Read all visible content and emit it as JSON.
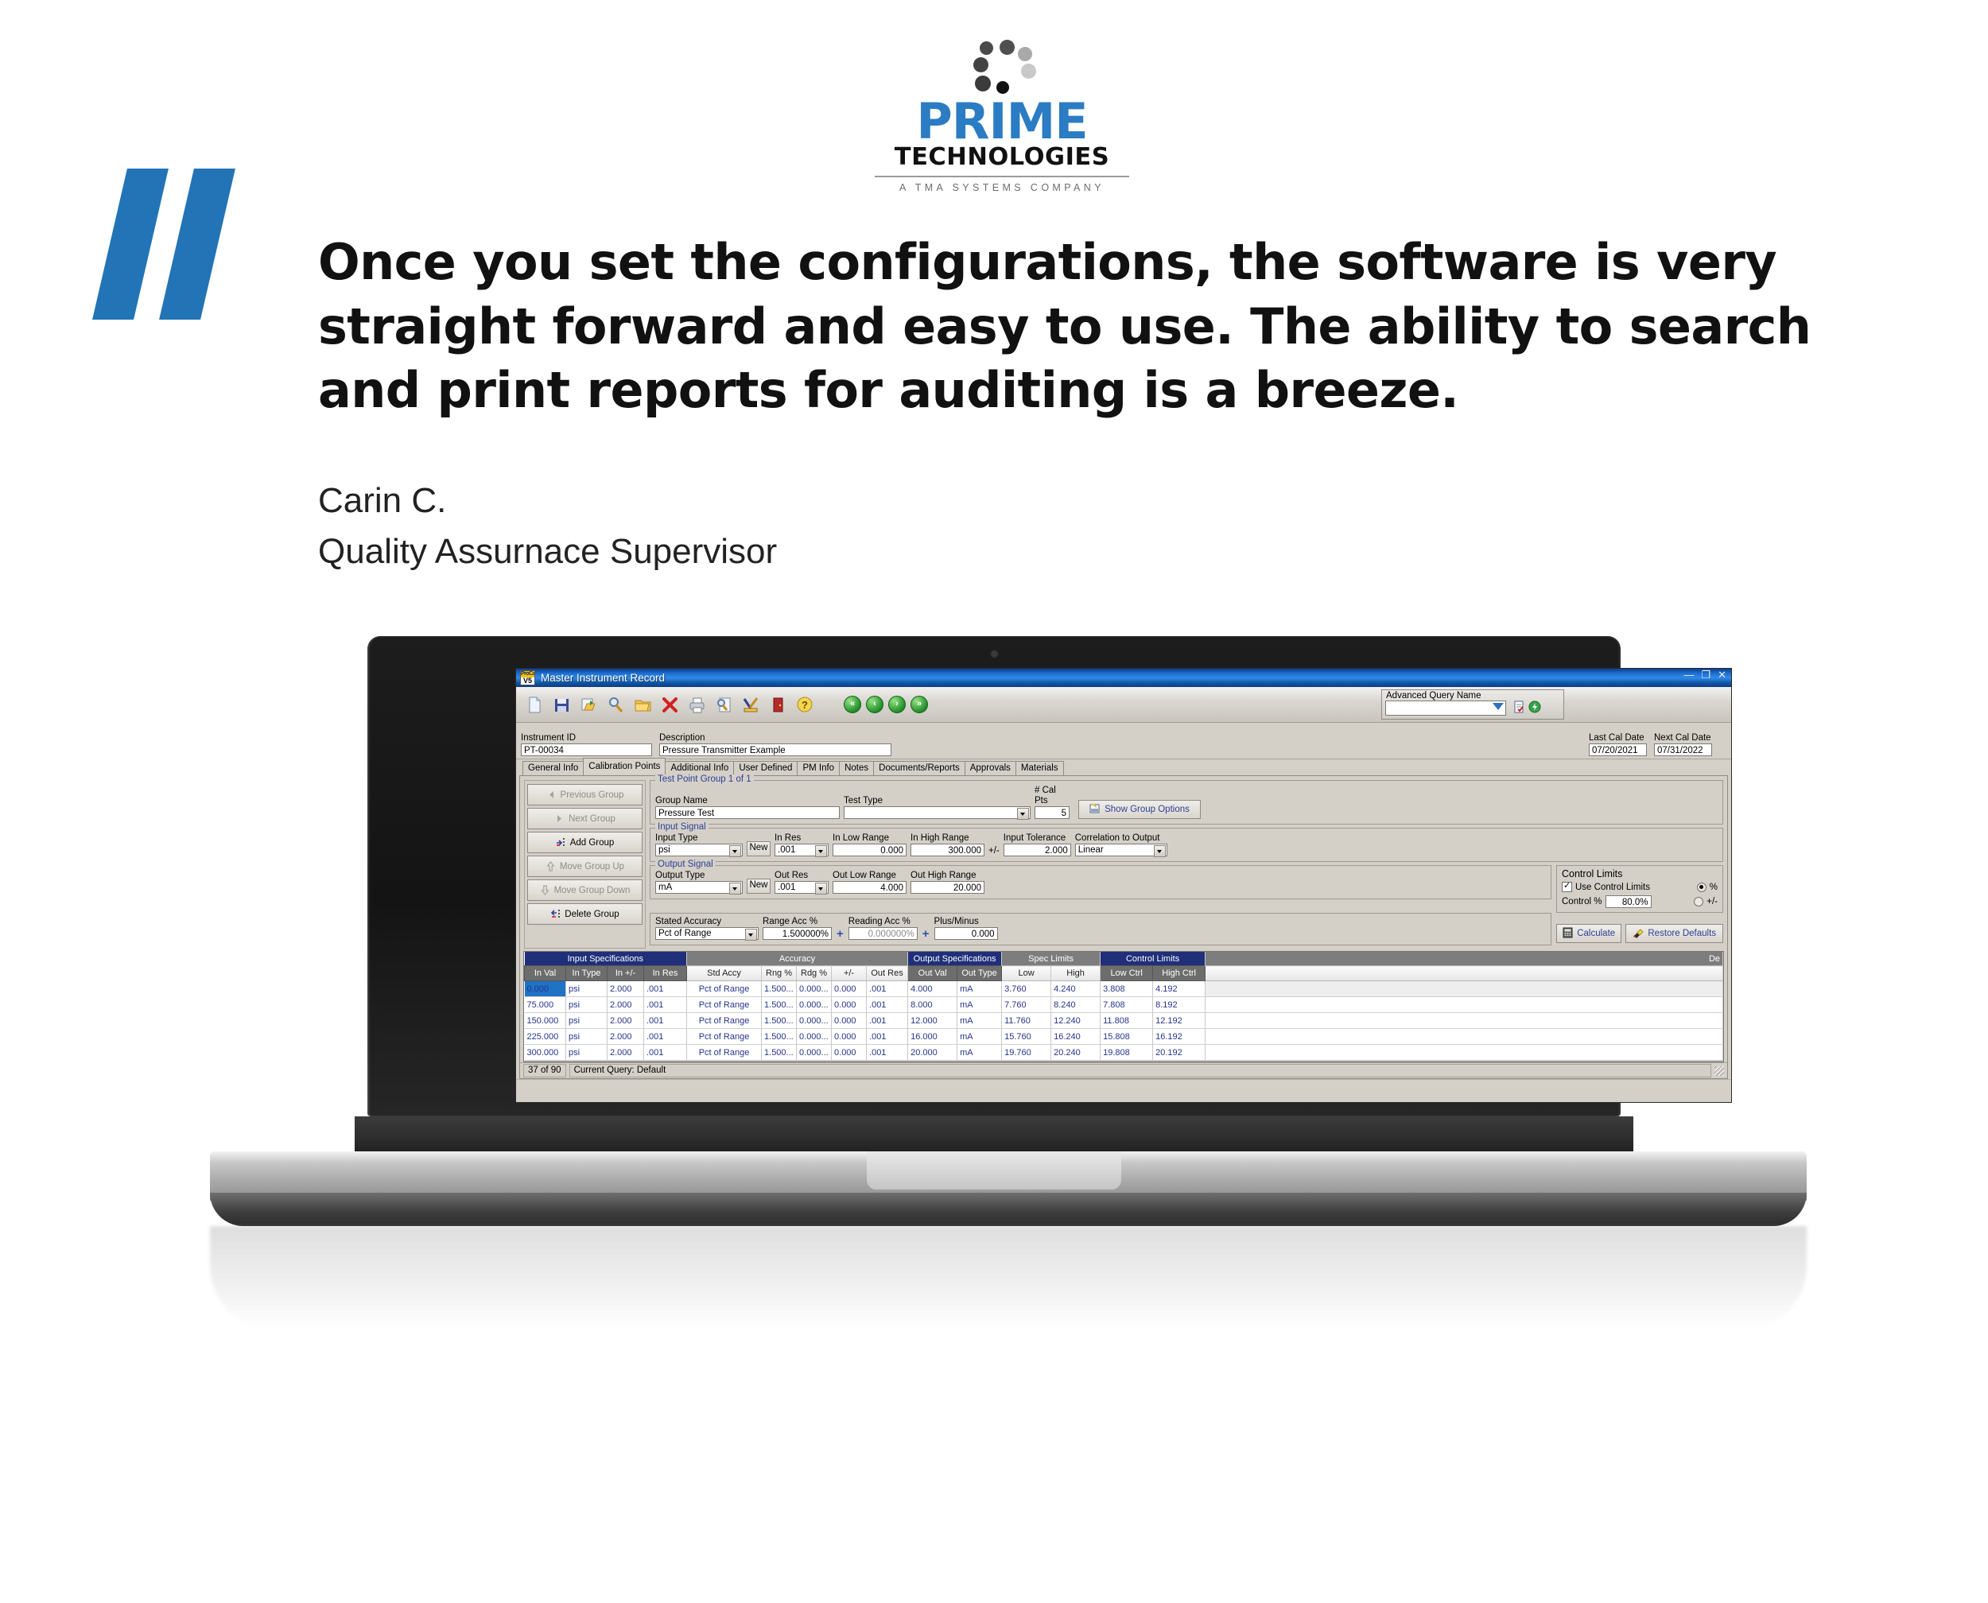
{
  "brand": {
    "name_primary": "PRIME",
    "name_secondary": "TECHNOLOGIES",
    "tagline": "A TMA SYSTEMS COMPANY"
  },
  "testimonial": {
    "quote": "Once you set the configurations, the software is very straight forward and easy to use. The ability to search and print reports for auditing is a breeze.",
    "author": "Carin C.",
    "role": "Quality Assurnace Supervisor"
  },
  "app": {
    "title": "Master Instrument Record",
    "icon_top": "ProCal",
    "icon_bottom": "V5",
    "window_buttons": {
      "minimize": "—",
      "maximize": "❐",
      "close": "✕"
    },
    "toolbar_icons": [
      "new-document-icon",
      "save-icon",
      "save-as-icon",
      "find-icon",
      "open-folder-icon",
      "delete-icon",
      "print-icon",
      "print-preview-icon",
      "edit-ruler-icon",
      "exit-door-icon",
      "help-icon"
    ],
    "nav_buttons": [
      "first-record",
      "previous-record",
      "next-record",
      "last-record"
    ],
    "advanced_query": {
      "label": "Advanced Query Name",
      "value": "",
      "placeholder": "",
      "icons": [
        "edit-query-icon",
        "run-query-icon"
      ]
    },
    "header_fields": [
      {
        "label": "Instrument ID",
        "value": "PT-00034"
      },
      {
        "label": "Description",
        "value": "Pressure Transmitter Example"
      },
      {
        "label": "Last Cal Date",
        "value": "07/20/2021"
      },
      {
        "label": "Next Cal Date",
        "value": "07/31/2022"
      }
    ],
    "tabs": [
      {
        "label": "General Info",
        "active": false
      },
      {
        "label": "Calibration Points",
        "active": true
      },
      {
        "label": "Additional Info",
        "active": false
      },
      {
        "label": "User Defined",
        "active": false
      },
      {
        "label": "PM Info",
        "active": false
      },
      {
        "label": "Notes",
        "active": false
      },
      {
        "label": "Documents/Reports",
        "active": false
      },
      {
        "label": "Approvals",
        "active": false
      },
      {
        "label": "Materials",
        "active": false
      }
    ],
    "group_buttons": [
      {
        "label": "Previous Group",
        "enabled": false,
        "icon": "left-triangle-icon"
      },
      {
        "label": "Next Group",
        "enabled": false,
        "icon": "right-triangle-icon"
      },
      {
        "label": "Add Group",
        "enabled": true,
        "icon": "add-group-icon"
      },
      {
        "label": "Move Group Up",
        "enabled": false,
        "icon": "up-arrow-icon"
      },
      {
        "label": "Move Group Down",
        "enabled": false,
        "icon": "down-arrow-icon"
      },
      {
        "label": "Delete Group",
        "enabled": true,
        "icon": "delete-group-icon"
      }
    ],
    "test_point_group": {
      "legend": "Test Point Group 1 of 1",
      "group_name_label": "Group Name",
      "group_name_value": "Pressure Test",
      "test_type_label": "Test Type",
      "test_type_value": "",
      "cal_pts_label": "# Cal Pts",
      "cal_pts_value": "5",
      "show_group_options": "Show Group Options"
    },
    "input_signal": {
      "legend": "Input Signal",
      "input_type_label": "Input Type",
      "input_type_value": "psi",
      "new_label": "New",
      "in_res_label": "In Res",
      "in_res_value": ".001",
      "in_low_label": "In Low Range",
      "in_low_value": "0.000",
      "in_high_label": "In High Range",
      "in_high_value": "300.000",
      "plus_minus": "+/-",
      "tolerance_label": "Input Tolerance",
      "tolerance_value": "2.000",
      "correlation_label": "Correlation to Output",
      "correlation_value": "Linear"
    },
    "output_signal": {
      "legend": "Output Signal",
      "output_type_label": "Output Type",
      "output_type_value": "mA",
      "new_label": "New",
      "out_res_label": "Out Res",
      "out_res_value": ".001",
      "out_low_label": "Out Low Range",
      "out_low_value": "4.000",
      "out_high_label": "Out High Range",
      "out_high_value": "20.000"
    },
    "stated_accuracy": {
      "label": "Stated Accuracy",
      "value": "Pct of Range",
      "range_acc_label": "Range Acc %",
      "range_acc_value": "1.500000%",
      "reading_acc_label": "Reading Acc %",
      "reading_acc_value": "0.000000%",
      "plus_minus_label": "Plus/Minus",
      "plus_minus_value": "0.000",
      "operator": "+"
    },
    "control_limits": {
      "legend": "Control Limits",
      "use_label": "Use Control Limits",
      "use_checked": true,
      "control_pct_label": "Control %",
      "control_pct_value": "80.0%",
      "radio_pct": "%",
      "radio_plusminus": "+/-",
      "radio_selected": "%"
    },
    "action_buttons": [
      {
        "label": "Calculate",
        "icon": "calculator-icon"
      },
      {
        "label": "Restore Defaults",
        "icon": "eraser-icon"
      }
    ],
    "grid": {
      "group_headers": [
        {
          "label": "Input Specifications",
          "span": 4,
          "style": "blue"
        },
        {
          "label": "Accuracy",
          "span": 5,
          "style": "gray"
        },
        {
          "label": "Output Specifications",
          "span": 2,
          "style": "blue"
        },
        {
          "label": "Spec Limits",
          "span": 2,
          "style": "gray"
        },
        {
          "label": "Control Limits",
          "span": 2,
          "style": "blue"
        },
        {
          "label": "De",
          "span": 1,
          "style": "gray"
        }
      ],
      "columns": [
        {
          "label": "In Val",
          "style": "dark"
        },
        {
          "label": "In Type",
          "style": "dark"
        },
        {
          "label": "In +/-",
          "style": "dark"
        },
        {
          "label": "In Res",
          "style": "dark"
        },
        {
          "label": "Std Accy",
          "style": "light"
        },
        {
          "label": "Rng %",
          "style": "light"
        },
        {
          "label": "Rdg %",
          "style": "light"
        },
        {
          "label": "+/-",
          "style": "light"
        },
        {
          "label": "Out Res",
          "style": "light"
        },
        {
          "label": "Out Val",
          "style": "dark"
        },
        {
          "label": "Out Type",
          "style": "dark"
        },
        {
          "label": "Low",
          "style": "light"
        },
        {
          "label": "High",
          "style": "light"
        },
        {
          "label": "Low Ctrl",
          "style": "dark"
        },
        {
          "label": "High Ctrl",
          "style": "dark"
        },
        {
          "label": "",
          "style": "light"
        }
      ],
      "rows": [
        {
          "selected_index": 0,
          "cells": [
            "0.000",
            "psi",
            "2.000",
            ".001",
            "Pct of Range",
            "1.500...",
            "0.000...",
            "0.000",
            ".001",
            "4.000",
            "mA",
            "3.760",
            "4.240",
            "3.808",
            "4.192",
            ""
          ]
        },
        {
          "selected_index": -1,
          "cells": [
            "75.000",
            "psi",
            "2.000",
            ".001",
            "Pct of Range",
            "1.500...",
            "0.000...",
            "0.000",
            ".001",
            "8.000",
            "mA",
            "7.760",
            "8.240",
            "7.808",
            "8.192",
            ""
          ]
        },
        {
          "selected_index": -1,
          "cells": [
            "150.000",
            "psi",
            "2.000",
            ".001",
            "Pct of Range",
            "1.500...",
            "0.000...",
            "0.000",
            ".001",
            "12.000",
            "mA",
            "11.760",
            "12.240",
            "11.808",
            "12.192",
            ""
          ]
        },
        {
          "selected_index": -1,
          "cells": [
            "225.000",
            "psi",
            "2.000",
            ".001",
            "Pct of Range",
            "1.500...",
            "0.000...",
            "0.000",
            ".001",
            "16.000",
            "mA",
            "15.760",
            "16.240",
            "15.808",
            "16.192",
            ""
          ]
        },
        {
          "selected_index": -1,
          "cells": [
            "300.000",
            "psi",
            "2.000",
            ".001",
            "Pct of Range",
            "1.500...",
            "0.000...",
            "0.000",
            ".001",
            "20.000",
            "mA",
            "19.760",
            "20.240",
            "19.808",
            "20.192",
            ""
          ]
        }
      ],
      "scroll_left": "‹",
      "scroll_right": "›"
    },
    "status_bar": {
      "record_count": "37 of 90",
      "query": "Current Query: Default"
    }
  },
  "colors": {
    "brand_blue": "#2b7cc3",
    "quote_bar": "#2274b6",
    "title_blue": "#1f6fd0",
    "grid_header_blue": "#1f2f7a",
    "grid_header_gray": "#7d7d7d",
    "grid_text": "#27348b",
    "selection": "#1f72c4",
    "chrome": "#d4d0c8"
  }
}
